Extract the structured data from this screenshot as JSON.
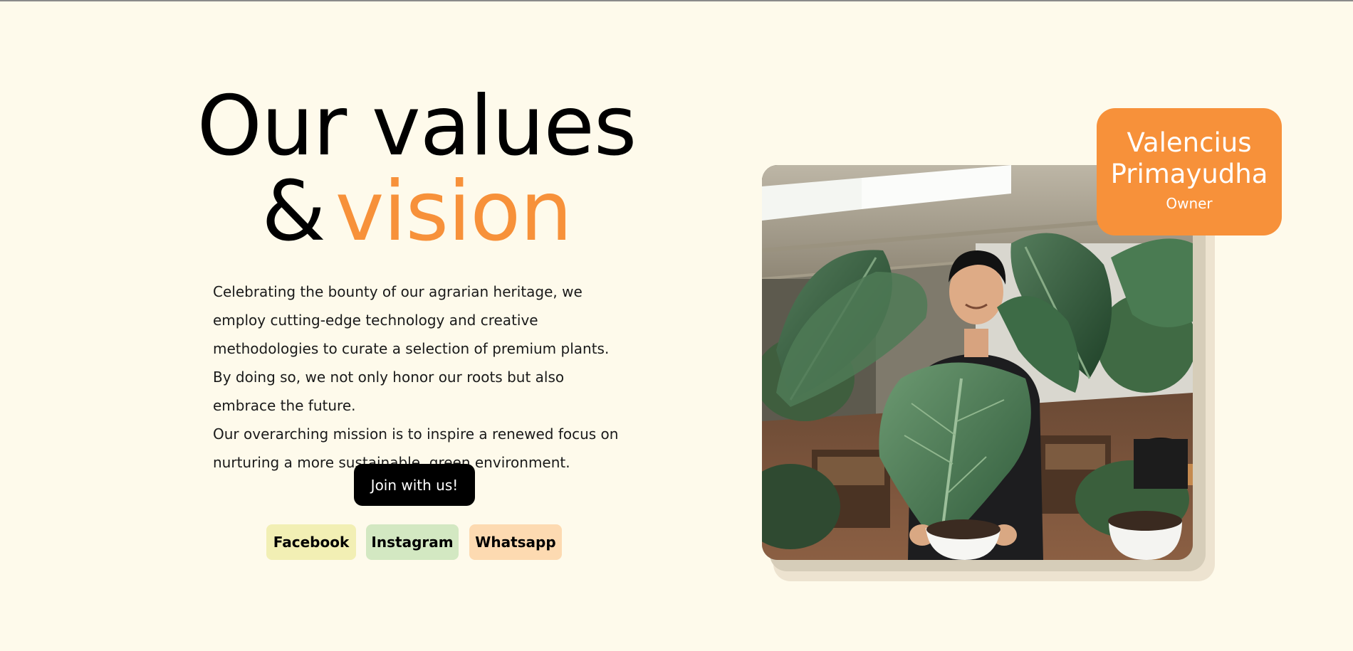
{
  "hero": {
    "heading_line1": "Our values",
    "heading_amp": "&",
    "heading_accent": "vision",
    "paragraph_1": "Celebrating the bounty of our agrarian heritage, we employ cutting-edge technology and creative methodologies to curate a selection of premium plants. By doing so, we not only honor our roots but also embrace the future.",
    "paragraph_2": "Our overarching mission is to inspire a renewed focus on nurturing a more sustainable, green environment.",
    "cta_label": "Join with us!"
  },
  "social": {
    "facebook": "Facebook",
    "instagram": "Instagram",
    "whatsapp": "Whatsapp"
  },
  "owner": {
    "first_name": "Valencius",
    "last_name": "Primayudha",
    "role": "Owner"
  },
  "colors": {
    "background": "#fefaeb",
    "accent": "#f7913a",
    "facebook_chip": "#f2efb4",
    "instagram_chip": "#d3e8c2",
    "whatsapp_chip": "#fddab1"
  },
  "images": {
    "portrait": "owner-with-plants-photo"
  }
}
